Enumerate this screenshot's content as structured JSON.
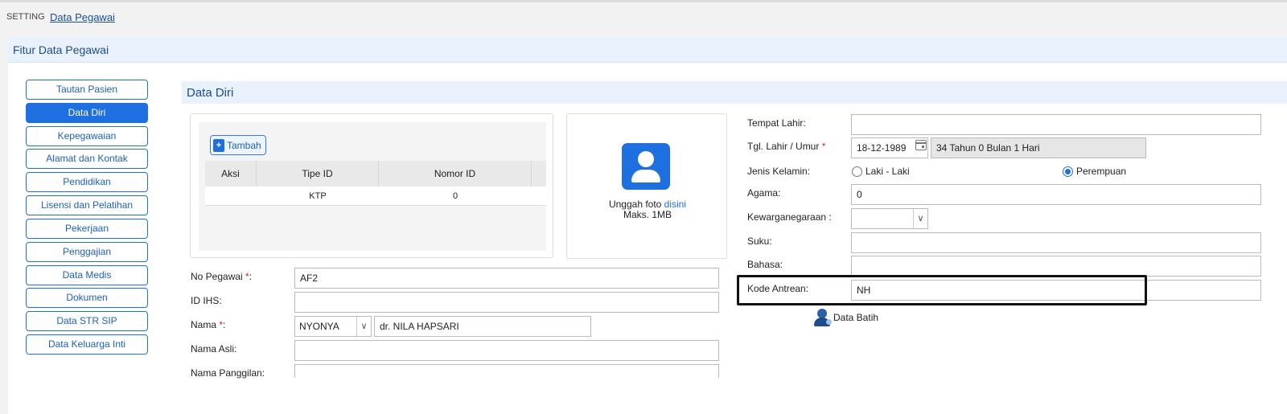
{
  "breadcrumb": {
    "root": "SETTING",
    "current": "Data Pegawai"
  },
  "panel": {
    "title": "Fitur Data Pegawai"
  },
  "tabs": [
    {
      "label": "Tautan Pasien",
      "active": false
    },
    {
      "label": "Data Diri",
      "active": true
    },
    {
      "label": "Kepegawaian",
      "active": false
    },
    {
      "label": "Alamat dan Kontak",
      "active": false
    },
    {
      "label": "Pendidikan",
      "active": false
    },
    {
      "label": "Lisensi dan Pelatihan",
      "active": false
    },
    {
      "label": "Pekerjaan",
      "active": false
    },
    {
      "label": "Penggajian",
      "active": false
    },
    {
      "label": "Data Medis",
      "active": false
    },
    {
      "label": "Dokumen",
      "active": false
    },
    {
      "label": "Data STR SIP",
      "active": false
    },
    {
      "label": "Data Keluarga Inti",
      "active": false
    }
  ],
  "section": {
    "title": "Data Diri"
  },
  "id_table": {
    "add_label": "Tambah",
    "columns": [
      "Aksi",
      "Tipe ID",
      "Nomor ID"
    ],
    "rows": [
      {
        "aksi": "",
        "tipe": "KTP",
        "nomor": "0"
      }
    ]
  },
  "photo": {
    "text_prefix": "Unggah foto ",
    "link": "disini",
    "max_size": "Maks. 1MB"
  },
  "left_form": {
    "no_pegawai": {
      "label": "No Pegawai ",
      "required_mark": "*",
      "suffix": ":",
      "value": "AF2"
    },
    "id_ihs": {
      "label": "ID IHS:",
      "value": ""
    },
    "nama": {
      "label": "Nama ",
      "required_mark": "*",
      "suffix": ":",
      "title": "NYONYA",
      "value": "dr. NILA HAPSARI"
    },
    "nama_asli": {
      "label": "Nama Asli:",
      "value": ""
    },
    "nama_panggilan": {
      "label": "Nama Panggilan:",
      "value": ""
    }
  },
  "right_form": {
    "tempat_lahir": {
      "label": "Tempat Lahir:",
      "value": ""
    },
    "tgl_lahir": {
      "label": "Tgl. Lahir / Umur ",
      "required_mark": "*",
      "value": "18-12-1989",
      "age": "34 Tahun 0 Bulan 1 Hari"
    },
    "jenis_kelamin": {
      "label": "Jenis Kelamin:",
      "option_male": "Laki - Laki",
      "option_female": "Perempuan",
      "selected": "Perempuan"
    },
    "agama": {
      "label": "Agama:",
      "value": "0"
    },
    "kewarganegaraan": {
      "label": "Kewarganegaraan :",
      "value": ""
    },
    "suku": {
      "label": "Suku:",
      "value": ""
    },
    "bahasa": {
      "label": "Bahasa:",
      "value": ""
    },
    "kode_antrean": {
      "label": "Kode Antrean:",
      "value": "NH"
    }
  },
  "data_batih": {
    "label": "Data Batih"
  },
  "colors": {
    "accent": "#1e6fe0",
    "required": "#d9231f",
    "header_bg": "#e8f1fc",
    "highlight_border": "#111111"
  }
}
